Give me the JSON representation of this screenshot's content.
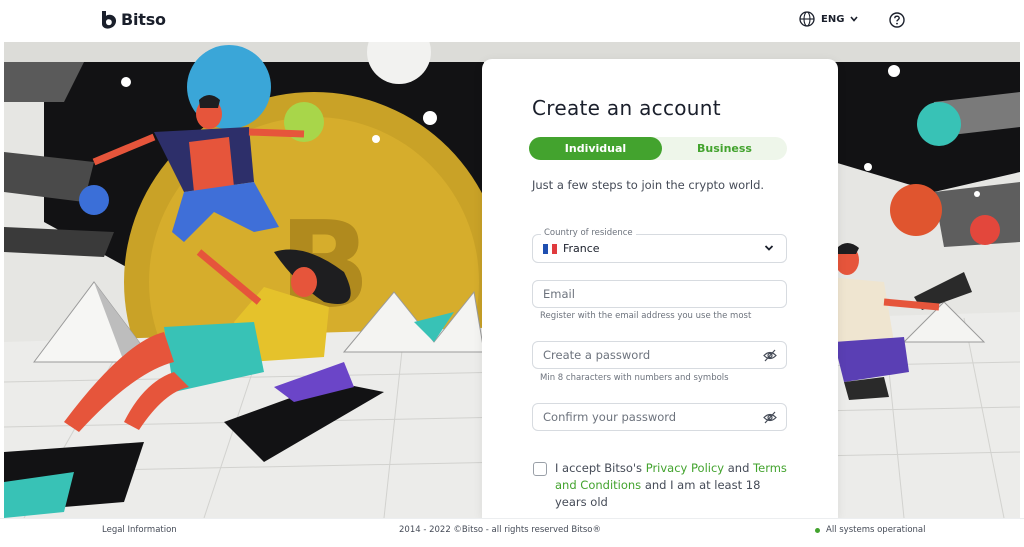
{
  "header": {
    "brand": "Bitso",
    "language": "ENG"
  },
  "signup": {
    "title": "Create an account",
    "tabs": [
      {
        "label": "Individual",
        "active": true
      },
      {
        "label": "Business",
        "active": false
      }
    ],
    "subtitle": "Just a few steps to join the crypto world.",
    "country": {
      "label": "Country of residence",
      "value": "France"
    },
    "email": {
      "placeholder": "Email",
      "hint": "Register with the email address you use the most"
    },
    "password": {
      "placeholder": "Create a password",
      "hint": "Min 8 characters with numbers and symbols"
    },
    "confirm_password": {
      "placeholder": "Confirm your password"
    },
    "terms": {
      "prefix": "I accept Bitso's ",
      "privacy_link": "Privacy Policy",
      "middle": " and ",
      "terms_link": "Terms and Conditions",
      "suffix": " and I am at least 18 years old",
      "checked": false
    }
  },
  "footer": {
    "legal": "Legal Information",
    "copyright": "2014 - 2022 ©Bitso - all rights reserved Bitso®",
    "status": "All systems operational"
  },
  "colors": {
    "brand_green": "#43a32e",
    "status_green": "#43a32e",
    "text_dark": "#1a1f2b"
  }
}
